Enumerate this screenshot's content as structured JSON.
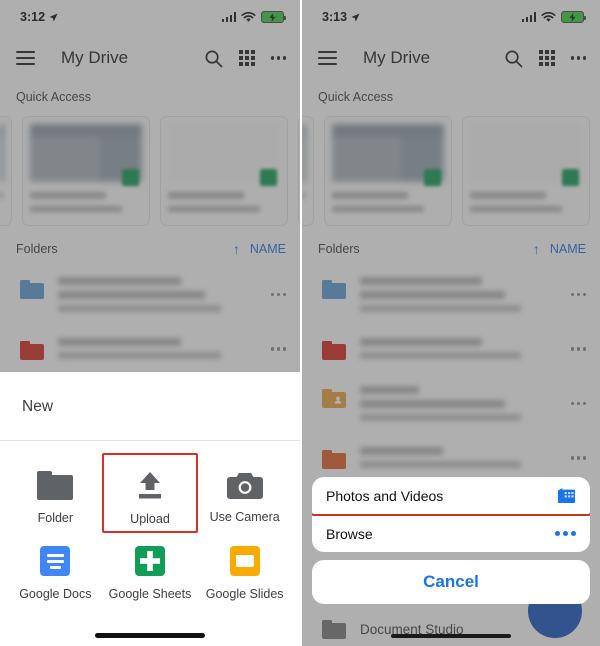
{
  "panels": [
    {
      "id": "left",
      "status": {
        "time": "3:12",
        "location_icon": "location-arrow-icon",
        "signal_icon": "cellular-signal-icon",
        "wifi_icon": "wifi-icon",
        "battery_icon": "battery-charging-icon"
      },
      "appbar": {
        "menu_icon": "hamburger-menu-icon",
        "title": "My Drive",
        "search_icon": "search-icon",
        "grid_icon": "grid-view-icon",
        "overflow_icon": "more-options-icon"
      },
      "quick_access": {
        "label": "Quick Access"
      },
      "folders_header": {
        "label": "Folders",
        "sort_direction_icon": "sort-ascending-icon",
        "sort_by": "NAME"
      },
      "sheet": {
        "title": "New",
        "items": [
          {
            "label": "Folder",
            "icon": "folder-icon",
            "highlighted": false
          },
          {
            "label": "Upload",
            "icon": "upload-icon",
            "highlighted": true
          },
          {
            "label": "Use Camera",
            "icon": "camera-icon",
            "highlighted": false
          },
          {
            "label": "Google Docs",
            "icon": "google-docs-icon",
            "highlighted": false
          },
          {
            "label": "Google Sheets",
            "icon": "google-sheets-icon",
            "highlighted": false
          },
          {
            "label": "Google Slides",
            "icon": "google-slides-icon",
            "highlighted": false
          }
        ]
      }
    },
    {
      "id": "right",
      "status": {
        "time": "3:13",
        "location_icon": "location-arrow-icon",
        "signal_icon": "cellular-signal-icon",
        "wifi_icon": "wifi-icon",
        "battery_icon": "battery-charging-icon"
      },
      "appbar": {
        "menu_icon": "hamburger-menu-icon",
        "title": "My Drive",
        "search_icon": "search-icon",
        "grid_icon": "grid-view-icon",
        "overflow_icon": "more-options-icon"
      },
      "quick_access": {
        "label": "Quick Access"
      },
      "folders_header": {
        "label": "Folders",
        "sort_direction_icon": "sort-ascending-icon",
        "sort_by": "NAME"
      },
      "bottom_item": {
        "label": "Document Studio",
        "icon": "folder-icon"
      },
      "action_sheet": {
        "rows": [
          {
            "label": "Photos and Videos",
            "trailing_icon": "photos-videos-icon",
            "highlighted": true
          },
          {
            "label": "Browse",
            "trailing_icon": "more-options-icon",
            "highlighted": false
          }
        ],
        "cancel_label": "Cancel"
      }
    }
  ],
  "colors": {
    "highlight": "#d93025",
    "accent_blue": "#1a73e8",
    "folder_blue": "#5f9ed6",
    "folder_red": "#d62c20",
    "folder_yellow": "#e8a33d",
    "folder_orange": "#e2612a",
    "sheets_green": "#0f9d58",
    "docs_blue": "#4285f4",
    "slides_yellow": "#f9ab00",
    "battery_green": "#38d142"
  },
  "folder_rows": [
    {
      "color_key": "folder_blue",
      "shared": false
    },
    {
      "color_key": "folder_red",
      "shared": false
    },
    {
      "color_key": "folder_yellow",
      "shared": true
    },
    {
      "color_key": "folder_orange",
      "shared": false
    }
  ]
}
